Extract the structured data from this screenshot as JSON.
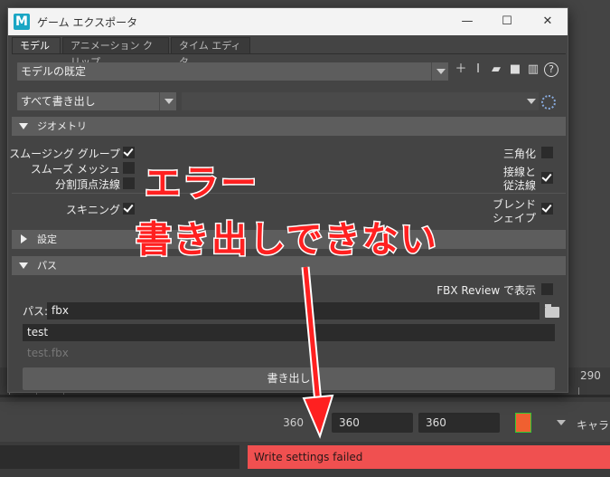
{
  "window": {
    "title": "ゲーム エクスポータ",
    "minimize": "—",
    "maximize": "☐",
    "close": "✕",
    "tabs": [
      "モデル",
      "アニメーション クリップ",
      "タイム エディタ"
    ]
  },
  "preset": {
    "value": "モデルの既定"
  },
  "export_mode": {
    "value": "すべて書き出し",
    "second_value": ""
  },
  "sections": {
    "geometry": "ジオメトリ",
    "settings": "設定",
    "path": "パス"
  },
  "geometry_options": {
    "smoothing_groups": {
      "label": "スムージング グループ",
      "checked": true
    },
    "smooth_mesh": {
      "label": "スムーズ メッシュ",
      "checked": false
    },
    "split_vertex_normals": {
      "label": "分割頂点法線",
      "checked": false
    },
    "skinning": {
      "label": "スキニング",
      "checked": true
    },
    "triangulate": {
      "label": "三角化",
      "checked": false
    },
    "tangents_binormals": {
      "label1": "接線と",
      "label2": "従法線",
      "checked": true
    },
    "blendshapes": {
      "label1": "ブレンド",
      "label2": "シェイプ",
      "checked": true
    }
  },
  "path_section": {
    "fbx_review_label": "FBX Review で表示",
    "path_label": "パス:",
    "path_value": "fbx",
    "name_value": "test",
    "file_preview": "test.fbx",
    "export_button": "書き出し"
  },
  "maya_background": {
    "timeline_end": "290",
    "range_values": [
      "360",
      "360",
      "360"
    ],
    "character_label": "キャラク",
    "command_error": "Write settings failed"
  },
  "annotations": {
    "line1": "エラー",
    "line2": "書き出しできない"
  },
  "colors": {
    "error_bg": "#f05050",
    "annotation": "#ff2020",
    "maya_logo": "#1aa6c4"
  }
}
